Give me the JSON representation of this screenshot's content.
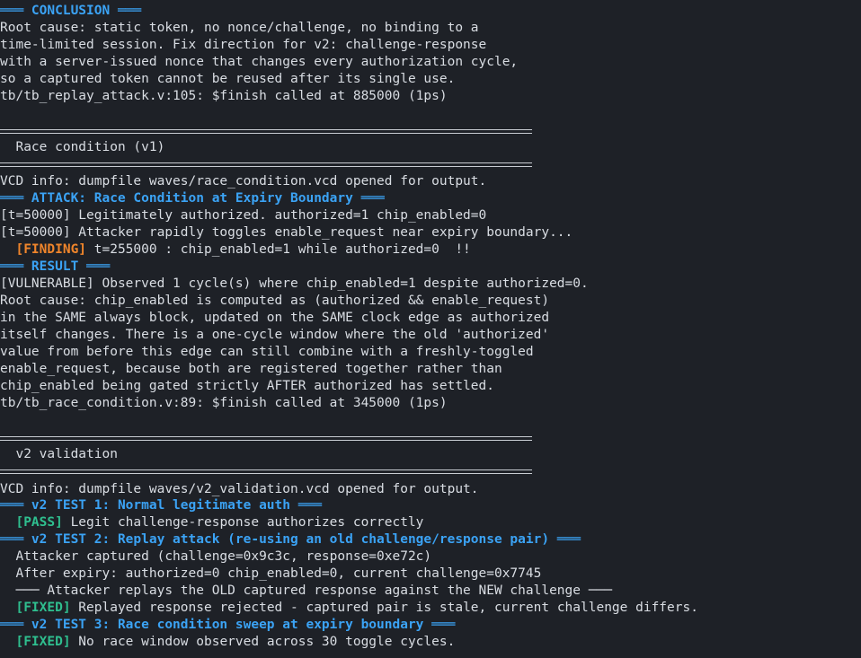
{
  "terminal": {
    "conclusion_header": "═══ CONCLUSION ═══",
    "conclusion_lines": [
      "Root cause: static token, no nonce/challenge, no binding to a",
      "time-limited session. Fix direction for v2: challenge-response",
      "with a server-issued nonce that changes every authorization cycle,",
      "so a captured token cannot be reused after its single use.",
      "tb/tb_replay_attack.v:105: $finish called at 885000 (1ps)"
    ],
    "race_title": "  Race condition (v1)",
    "race_vcd": "VCD info: dumpfile waves/race_condition.vcd opened for output.",
    "attack_header": "═══ ATTACK: Race Condition at Expiry Boundary ═══",
    "race_log": [
      "[t=50000] Legitimately authorized. authorized=1 chip_enabled=0",
      "[t=50000] Attacker rapidly toggles enable_request near expiry boundary..."
    ],
    "finding_tag": "  [FINDING]",
    "finding_text": " t=255000 : chip_enabled=1 while authorized=0  !!",
    "result_header": "═══ RESULT ═══",
    "result_lines": [
      "[VULNERABLE] Observed 1 cycle(s) where chip_enabled=1 despite authorized=0.",
      "Root cause: chip_enabled is computed as (authorized && enable_request)",
      "in the SAME always block, updated on the SAME clock edge as authorized",
      "itself changes. There is a one-cycle window where the old 'authorized'",
      "value from before this edge can still combine with a freshly-toggled",
      "enable_request, because both are registered together rather than",
      "chip_enabled being gated strictly AFTER authorized has settled.",
      "tb/tb_race_condition.v:89: $finish called at 345000 (1ps)"
    ],
    "v2_title": "  v2 validation",
    "v2_vcd": "VCD info: dumpfile waves/v2_validation.vcd opened for output.",
    "test1_header": "═══ v2 TEST 1: Normal legitimate auth ═══",
    "pass_tag": "  [PASS]",
    "pass_text": " Legit challenge-response authorizes correctly",
    "test2_header": "═══ v2 TEST 2: Replay attack (re-using an old challenge/response pair) ═══",
    "test2_lines": [
      "  Attacker captured (challenge=0x9c3c, response=0xe72c)",
      "  After expiry: authorized=0 chip_enabled=0, current challenge=0x7745",
      "  ─── Attacker replays the OLD captured response against the NEW challenge ───"
    ],
    "fixed_tag_1": "  [FIXED]",
    "fixed_text_1": " Replayed response rejected - captured pair is stale, current challenge differs.",
    "test3_header": "═══ v2 TEST 3: Race condition sweep at expiry boundary ═══",
    "fixed_tag_2": "  [FIXED]",
    "fixed_text_2": " No race window observed across 30 toggle cycles."
  },
  "colors": {
    "background": "#1e2127",
    "text": "#d9dde3",
    "header_blue": "#3ba3f5",
    "pass_green": "#2fbf8f",
    "finding_orange": "#f0852b"
  }
}
